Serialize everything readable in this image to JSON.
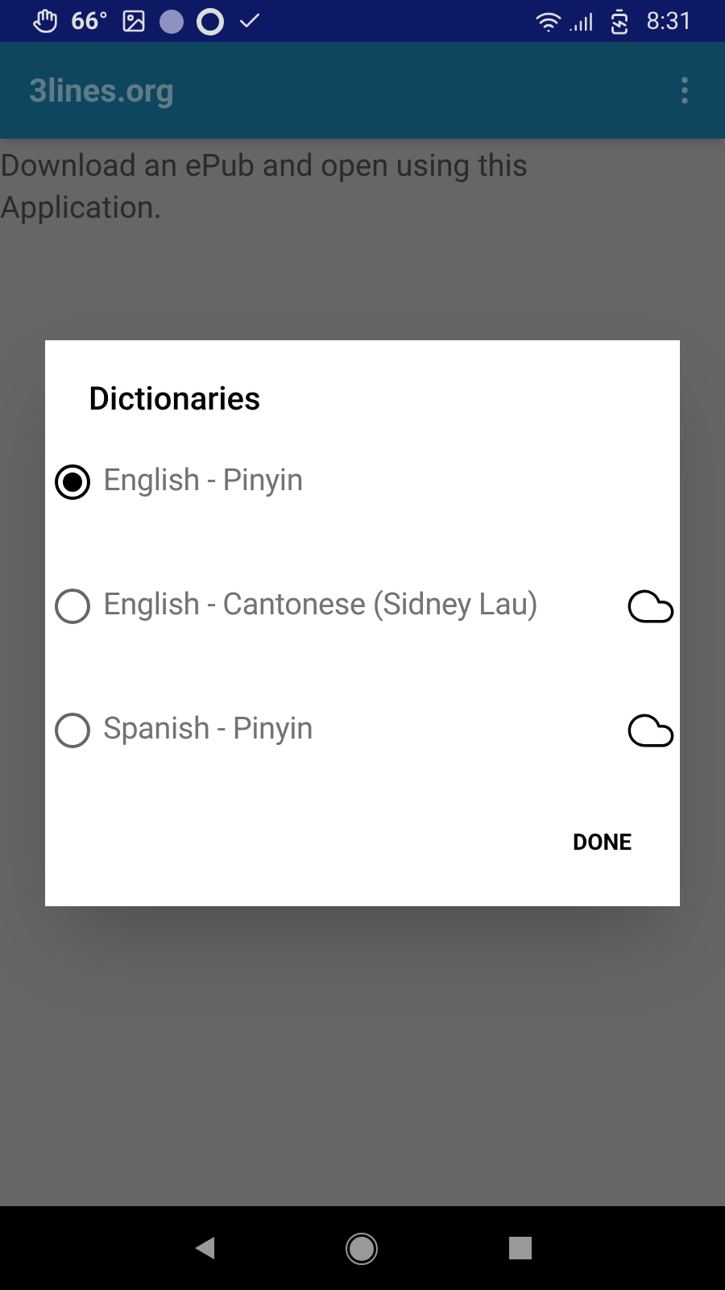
{
  "status_bar": {
    "temperature": "66°",
    "time": "8:31"
  },
  "app_bar": {
    "title": "3lines.org"
  },
  "content": {
    "message": "Download an ePub and open using this Application."
  },
  "dialog": {
    "title": "Dictionaries",
    "options": [
      {
        "label": "English - Pinyin",
        "selected": true,
        "cloud": false
      },
      {
        "label": "English - Cantonese (Sidney Lau)",
        "selected": false,
        "cloud": true
      },
      {
        "label": "Spanish - Pinyin",
        "selected": false,
        "cloud": true
      }
    ],
    "done_button": "DONE"
  }
}
